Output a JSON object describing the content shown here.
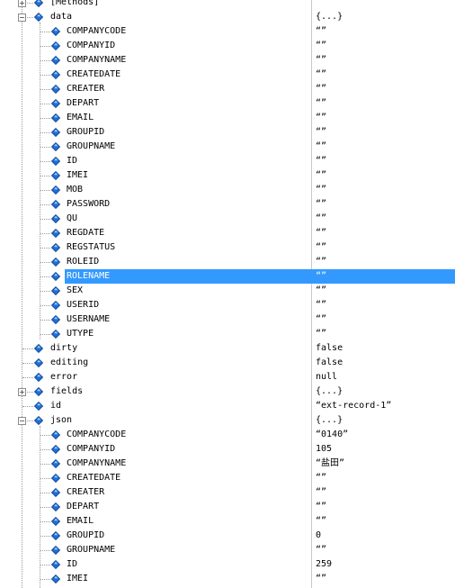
{
  "tree": {
    "rows": [
      {
        "name": "[Methods]",
        "value": "",
        "depth": 1,
        "expander": "+"
      },
      {
        "name": "data",
        "value": "{...}",
        "depth": 1,
        "expander": "-"
      },
      {
        "name": "COMPANYCODE",
        "value": "“”",
        "depth": 2,
        "expander": ""
      },
      {
        "name": "COMPANYID",
        "value": "“”",
        "depth": 2,
        "expander": ""
      },
      {
        "name": "COMPANYNAME",
        "value": "“”",
        "depth": 2,
        "expander": ""
      },
      {
        "name": "CREATEDATE",
        "value": "“”",
        "depth": 2,
        "expander": ""
      },
      {
        "name": "CREATER",
        "value": "“”",
        "depth": 2,
        "expander": ""
      },
      {
        "name": "DEPART",
        "value": "“”",
        "depth": 2,
        "expander": ""
      },
      {
        "name": "EMAIL",
        "value": "“”",
        "depth": 2,
        "expander": ""
      },
      {
        "name": "GROUPID",
        "value": "“”",
        "depth": 2,
        "expander": ""
      },
      {
        "name": "GROUPNAME",
        "value": "“”",
        "depth": 2,
        "expander": ""
      },
      {
        "name": "ID",
        "value": "“”",
        "depth": 2,
        "expander": ""
      },
      {
        "name": "IMEI",
        "value": "“”",
        "depth": 2,
        "expander": ""
      },
      {
        "name": "MOB",
        "value": "“”",
        "depth": 2,
        "expander": ""
      },
      {
        "name": "PASSWORD",
        "value": "“”",
        "depth": 2,
        "expander": ""
      },
      {
        "name": "QU",
        "value": "“”",
        "depth": 2,
        "expander": ""
      },
      {
        "name": "REGDATE",
        "value": "“”",
        "depth": 2,
        "expander": ""
      },
      {
        "name": "REGSTATUS",
        "value": "“”",
        "depth": 2,
        "expander": ""
      },
      {
        "name": "ROLEID",
        "value": "“”",
        "depth": 2,
        "expander": ""
      },
      {
        "name": "ROLENAME",
        "value": "“”",
        "depth": 2,
        "expander": "",
        "selected": true
      },
      {
        "name": "SEX",
        "value": "“”",
        "depth": 2,
        "expander": ""
      },
      {
        "name": "USERID",
        "value": "“”",
        "depth": 2,
        "expander": ""
      },
      {
        "name": "USERNAME",
        "value": "“”",
        "depth": 2,
        "expander": ""
      },
      {
        "name": "UTYPE",
        "value": "“”",
        "depth": 2,
        "expander": ""
      },
      {
        "name": "dirty",
        "value": "false",
        "depth": 1,
        "expander": ""
      },
      {
        "name": "editing",
        "value": "false",
        "depth": 1,
        "expander": ""
      },
      {
        "name": "error",
        "value": "null",
        "depth": 1,
        "expander": ""
      },
      {
        "name": "fields",
        "value": "{...}",
        "depth": 1,
        "expander": "+"
      },
      {
        "name": "id",
        "value": "“ext-record-1”",
        "depth": 1,
        "expander": ""
      },
      {
        "name": "json",
        "value": "{...}",
        "depth": 1,
        "expander": "-"
      },
      {
        "name": "COMPANYCODE",
        "value": "“0140”",
        "depth": 2,
        "expander": ""
      },
      {
        "name": "COMPANYID",
        "value": "105",
        "depth": 2,
        "expander": ""
      },
      {
        "name": "COMPANYNAME",
        "value": "“盐田”",
        "depth": 2,
        "expander": ""
      },
      {
        "name": "CREATEDATE",
        "value": "“”",
        "depth": 2,
        "expander": ""
      },
      {
        "name": "CREATER",
        "value": "“”",
        "depth": 2,
        "expander": ""
      },
      {
        "name": "DEPART",
        "value": "“”",
        "depth": 2,
        "expander": ""
      },
      {
        "name": "EMAIL",
        "value": "“”",
        "depth": 2,
        "expander": ""
      },
      {
        "name": "GROUPID",
        "value": "0",
        "depth": 2,
        "expander": ""
      },
      {
        "name": "GROUPNAME",
        "value": "“”",
        "depth": 2,
        "expander": ""
      },
      {
        "name": "ID",
        "value": "259",
        "depth": 2,
        "expander": ""
      },
      {
        "name": "IMEI",
        "value": "“”",
        "depth": 2,
        "expander": ""
      }
    ]
  },
  "colors": {
    "selection": "#3399ff",
    "icon_fill": "#1f6fd6",
    "icon_stroke": "#0a3f8c"
  },
  "icons": {
    "property": "property-diamond-icon",
    "expand": "expand-plus-icon",
    "collapse": "collapse-minus-icon"
  }
}
